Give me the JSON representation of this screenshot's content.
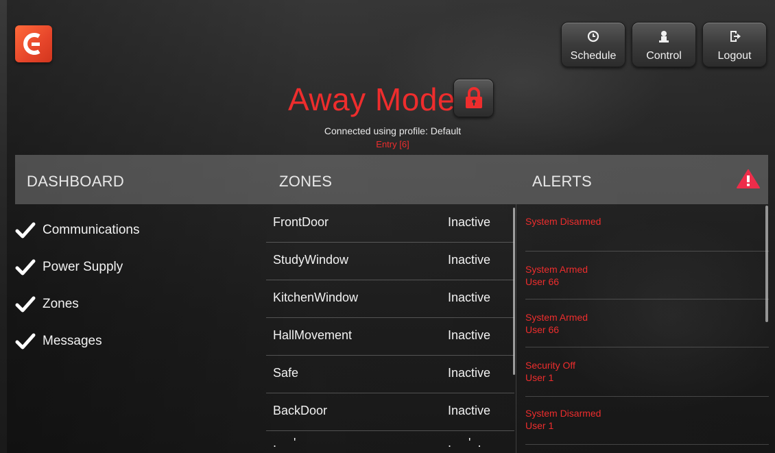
{
  "app": {
    "mode_title": "Away Mode",
    "profile_text": "Connected using profile: Default",
    "entry_text": "Entry [6]",
    "accent_color": "#ee2d2d"
  },
  "toolbar": {
    "schedule_label": "Schedule",
    "control_label": "Control",
    "logout_label": "Logout",
    "schedule_icon": "clock-icon",
    "control_icon": "person-icon",
    "logout_icon": "exit-icon"
  },
  "sections": {
    "dashboard": "DASHBOARD",
    "zones": "ZONES",
    "alerts": "ALERTS"
  },
  "dashboard": {
    "items": [
      {
        "label": "Communications",
        "icon": "check-icon"
      },
      {
        "label": "Power Supply",
        "icon": "check-icon"
      },
      {
        "label": "Zones",
        "icon": "check-icon"
      },
      {
        "label": "Messages",
        "icon": "check-icon"
      }
    ]
  },
  "zones": {
    "rows": [
      {
        "name": "FrontDoor",
        "status": "Inactive"
      },
      {
        "name": "StudyWindow",
        "status": "Inactive"
      },
      {
        "name": "KitchenWindow",
        "status": "Inactive"
      },
      {
        "name": "HallMovement",
        "status": "Inactive"
      },
      {
        "name": "Safe",
        "status": "Inactive"
      },
      {
        "name": "BackDoor",
        "status": "Inactive"
      }
    ]
  },
  "alerts": {
    "rows": [
      {
        "title": "System Disarmed",
        "user": ""
      },
      {
        "title": "System Armed",
        "user": "User 66"
      },
      {
        "title": "System Armed",
        "user": "User 66"
      },
      {
        "title": "Security Off",
        "user": "User 1"
      },
      {
        "title": "System Disarmed",
        "user": "User 1"
      }
    ]
  }
}
